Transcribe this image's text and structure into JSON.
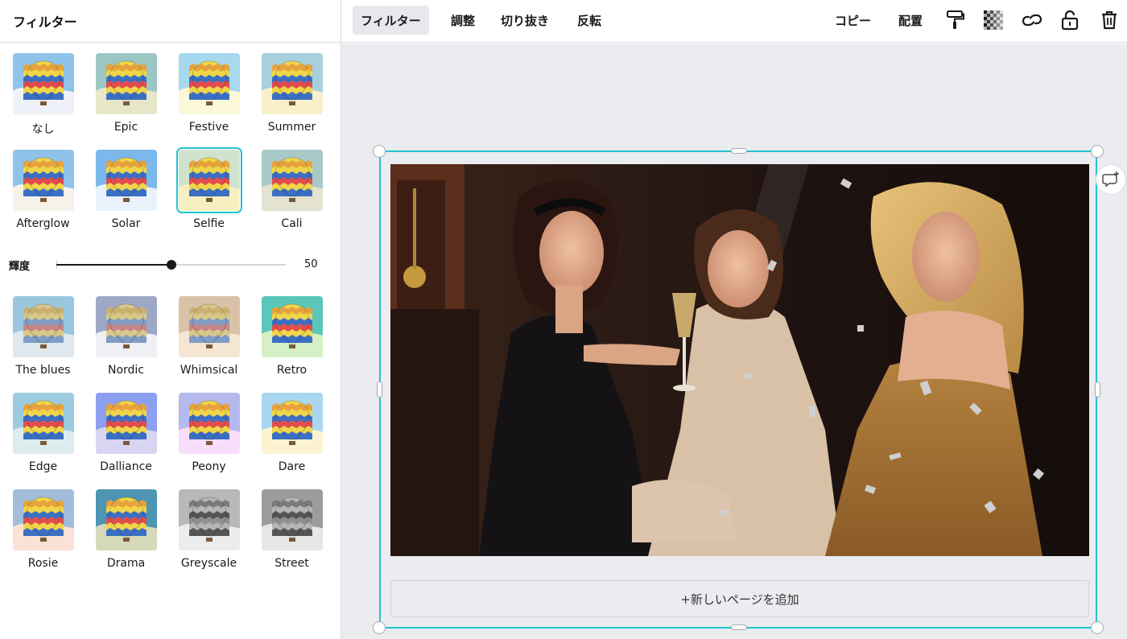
{
  "sidebar": {
    "title": "フィルター",
    "filters_top": [
      {
        "label": "なし"
      },
      {
        "label": "Epic"
      },
      {
        "label": "Festive"
      },
      {
        "label": "Summer"
      },
      {
        "label": "Afterglow"
      },
      {
        "label": "Solar"
      },
      {
        "label": "Selfie",
        "selected": true
      },
      {
        "label": "Cali"
      }
    ],
    "slider": {
      "label": "輝度",
      "value": "50",
      "fraction": 0.5
    },
    "filters_bottom": [
      {
        "label": "The blues"
      },
      {
        "label": "Nordic"
      },
      {
        "label": "Whimsical"
      },
      {
        "label": "Retro"
      },
      {
        "label": "Edge"
      },
      {
        "label": "Dalliance"
      },
      {
        "label": "Peony"
      },
      {
        "label": "Dare"
      },
      {
        "label": "Rosie"
      },
      {
        "label": "Drama"
      },
      {
        "label": "Greyscale"
      },
      {
        "label": "Street"
      }
    ]
  },
  "toolbar": {
    "filter": "フィルター",
    "adjust": "調整",
    "crop": "切り抜き",
    "flip": "反転",
    "copy": "コピー",
    "arrange": "配置",
    "icons": [
      "paint-roller-icon",
      "transparency-icon",
      "link-icon",
      "lock-icon",
      "trash-icon"
    ]
  },
  "canvas": {
    "add_page": "+新しいページを追加",
    "page_tools": [
      "note-icon",
      "duplicate-icon",
      "add-icon"
    ],
    "selection_color": "#21c3cf"
  },
  "thumb_tints": {
    "なし": {
      "sky": "#8fc3ea",
      "ground": "#eef2f8",
      "balloon": "color"
    },
    "Epic": {
      "sky": "#9cc6c4",
      "ground": "#e6e7c8",
      "balloon": "color"
    },
    "Festive": {
      "sky": "#a8d8ee",
      "ground": "#fbf9d9",
      "balloon": "color"
    },
    "Summer": {
      "sky": "#a6d0de",
      "ground": "#f8f1c8",
      "balloon": "color"
    },
    "Afterglow": {
      "sky": "#8fc3ea",
      "ground": "#f6f2ea",
      "balloon": "color"
    },
    "Solar": {
      "sky": "#7bb8ec",
      "ground": "#e9f1fb",
      "balloon": "color"
    },
    "Selfie": {
      "sky": "#cfe3cf",
      "ground": "#f6f0c0",
      "balloon": "color"
    },
    "Cali": {
      "sky": "#a9c9c8",
      "ground": "#e3e3cf",
      "balloon": "color"
    },
    "The blues": {
      "sky": "#9ac7df",
      "ground": "#dfe8ec",
      "balloon": "muted"
    },
    "Nordic": {
      "sky": "#9ea8c6",
      "ground": "#eef0f4",
      "balloon": "muted"
    },
    "Whimsical": {
      "sky": "#d9c2a8",
      "ground": "#f4e6d3",
      "balloon": "muted"
    },
    "Retro": {
      "sky": "#5bc7b9",
      "ground": "#d5f0c4",
      "balloon": "color"
    },
    "Edge": {
      "sky": "#9ccbe0",
      "ground": "#dcecef",
      "balloon": "color"
    },
    "Dalliance": {
      "sky": "#8c9ff0",
      "ground": "#d8d5f2",
      "balloon": "color"
    },
    "Peony": {
      "sky": "#b4b9ee",
      "ground": "#f9defb",
      "balloon": "color"
    },
    "Dare": {
      "sky": "#a9d7f0",
      "ground": "#fbf3d0",
      "balloon": "color"
    },
    "Rosie": {
      "sky": "#a2bcd9",
      "ground": "#fbe2d6",
      "balloon": "color"
    },
    "Drama": {
      "sky": "#4d95b3",
      "ground": "#d6d9b7",
      "balloon": "color"
    },
    "Greyscale": {
      "sky": "#b9b9b9",
      "ground": "#ececec",
      "balloon": "grey"
    },
    "Street": {
      "sky": "#9c9c9c",
      "ground": "#e7e7e7",
      "balloon": "grey"
    }
  }
}
